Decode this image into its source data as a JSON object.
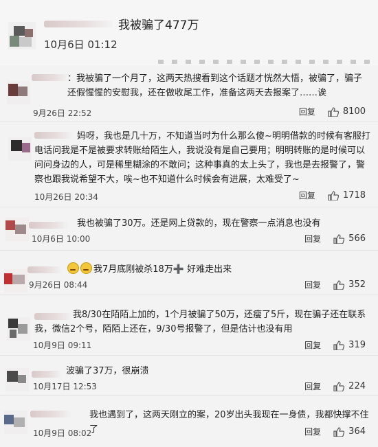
{
  "header": {
    "title": "我被骗了477万",
    "time": "10月6日 01:12"
  },
  "reply_label": "回复",
  "comments": [
    {
      "text": "：我被骗了一个月了，这两天热搜看到这个话题才恍然大悟，被骗了，骗子还假惺惺的安慰我，还在做收尾工作，准备这两天去报案了……诶",
      "time": "9月26日 22:52",
      "likes": "8100"
    },
    {
      "text": "妈呀，我也是几十万，不知道当时为什么那么傻~明明借款的时候有客服打电话问我是不是被要求转账给陌生人，我说没有是自己要用；明明转账的是时候可以问问身边的人，可是稀里糊涂的不敢问；这种事真的太上头了，我也是去报警了，警察也跟我说希望不大，唉~也不知道什么时候会有进展，太难受了~",
      "time": "10月26日 20:34",
      "likes": "1718"
    },
    {
      "text": "我也被骗了30万。还是网上贷款的，现在警察一点消息也没有",
      "time": "10月6日 10:00",
      "likes": "566"
    },
    {
      "text": "我7月底刚被杀18万➕ 好难走出来",
      "time": "9月26日 08:44",
      "likes": "352"
    },
    {
      "text": "我8/30在陌陌上加的，1个月被骗了50万，还瘦了5斤，现在骗子还在联系我，微信2个号，陌陌上还在，9/30号报警了，但是估计也没有用",
      "time": "10月9日 09:11",
      "likes": "319"
    },
    {
      "text": "波骗了37万，很崩溃",
      "time": "10月17日 12:53",
      "likes": "224"
    },
    {
      "text": "我也遇到了，这两天刚立的案，20岁出头我现在一身债，我都快撑不住了",
      "time": "10月9日 08:02",
      "likes": "364"
    }
  ]
}
